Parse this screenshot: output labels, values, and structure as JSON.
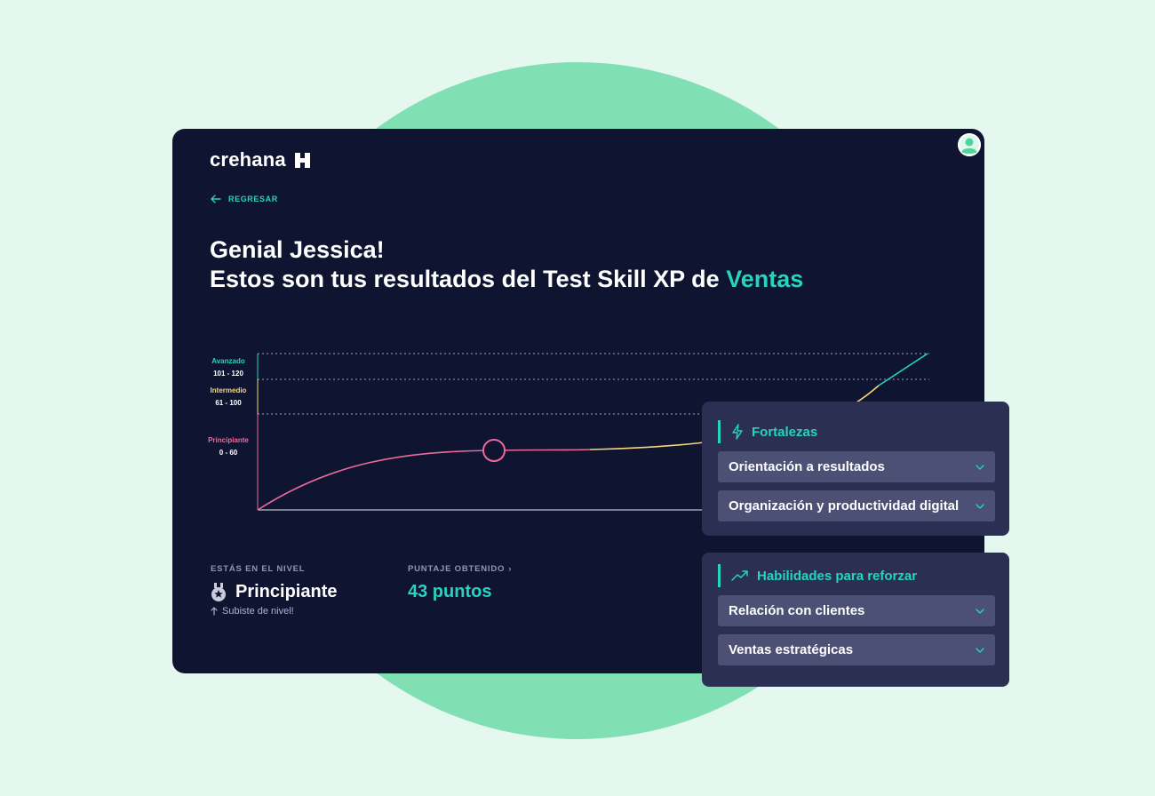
{
  "brand": {
    "name": "crehana"
  },
  "nav": {
    "back_label": "REGRESAR"
  },
  "headline": {
    "line1": "Genial Jessica!",
    "line2_prefix": "Estos son tus resultados del Test Skill XP de ",
    "line2_accent": "Ventas"
  },
  "chart_data": {
    "type": "line",
    "levels": [
      {
        "name": "Avanzado",
        "range": "101 - 120",
        "min": 101,
        "max": 120,
        "color": "#26d3c1"
      },
      {
        "name": "Intermedio",
        "range": "61 - 100",
        "min": 61,
        "max": 100,
        "color": "#f5d77a"
      },
      {
        "name": "Principiante",
        "range": "0 - 60",
        "min": 0,
        "max": 60,
        "color": "#ec6a9b"
      }
    ],
    "current_score": 43,
    "grid": true
  },
  "stats": {
    "level_label": "ESTÁS EN EL NIVEL",
    "level_value": "Principiante",
    "level_note": "Subiste de nivel!",
    "score_label": "PUNTAJE OBTENIDO",
    "score_chevron": "›",
    "score_value": "43 puntos"
  },
  "strengths": {
    "title": "Fortalezas",
    "icon": "lightning-icon",
    "items": [
      {
        "label": "Orientación a resultados"
      },
      {
        "label": "Organización y productividad digital"
      }
    ]
  },
  "improve": {
    "title": "Habilidades para reforzar",
    "icon": "trending-up-icon",
    "items": [
      {
        "label": "Relación con clientes"
      },
      {
        "label": "Ventas estratégicas"
      }
    ]
  },
  "colors": {
    "accent": "#26d3c1",
    "card_bg": "#0f1530",
    "panel_bg": "#2b2f51",
    "panel_item_bg": "#4c5075",
    "page_bg": "#e4f8ef",
    "circle": "#80e0b3"
  }
}
